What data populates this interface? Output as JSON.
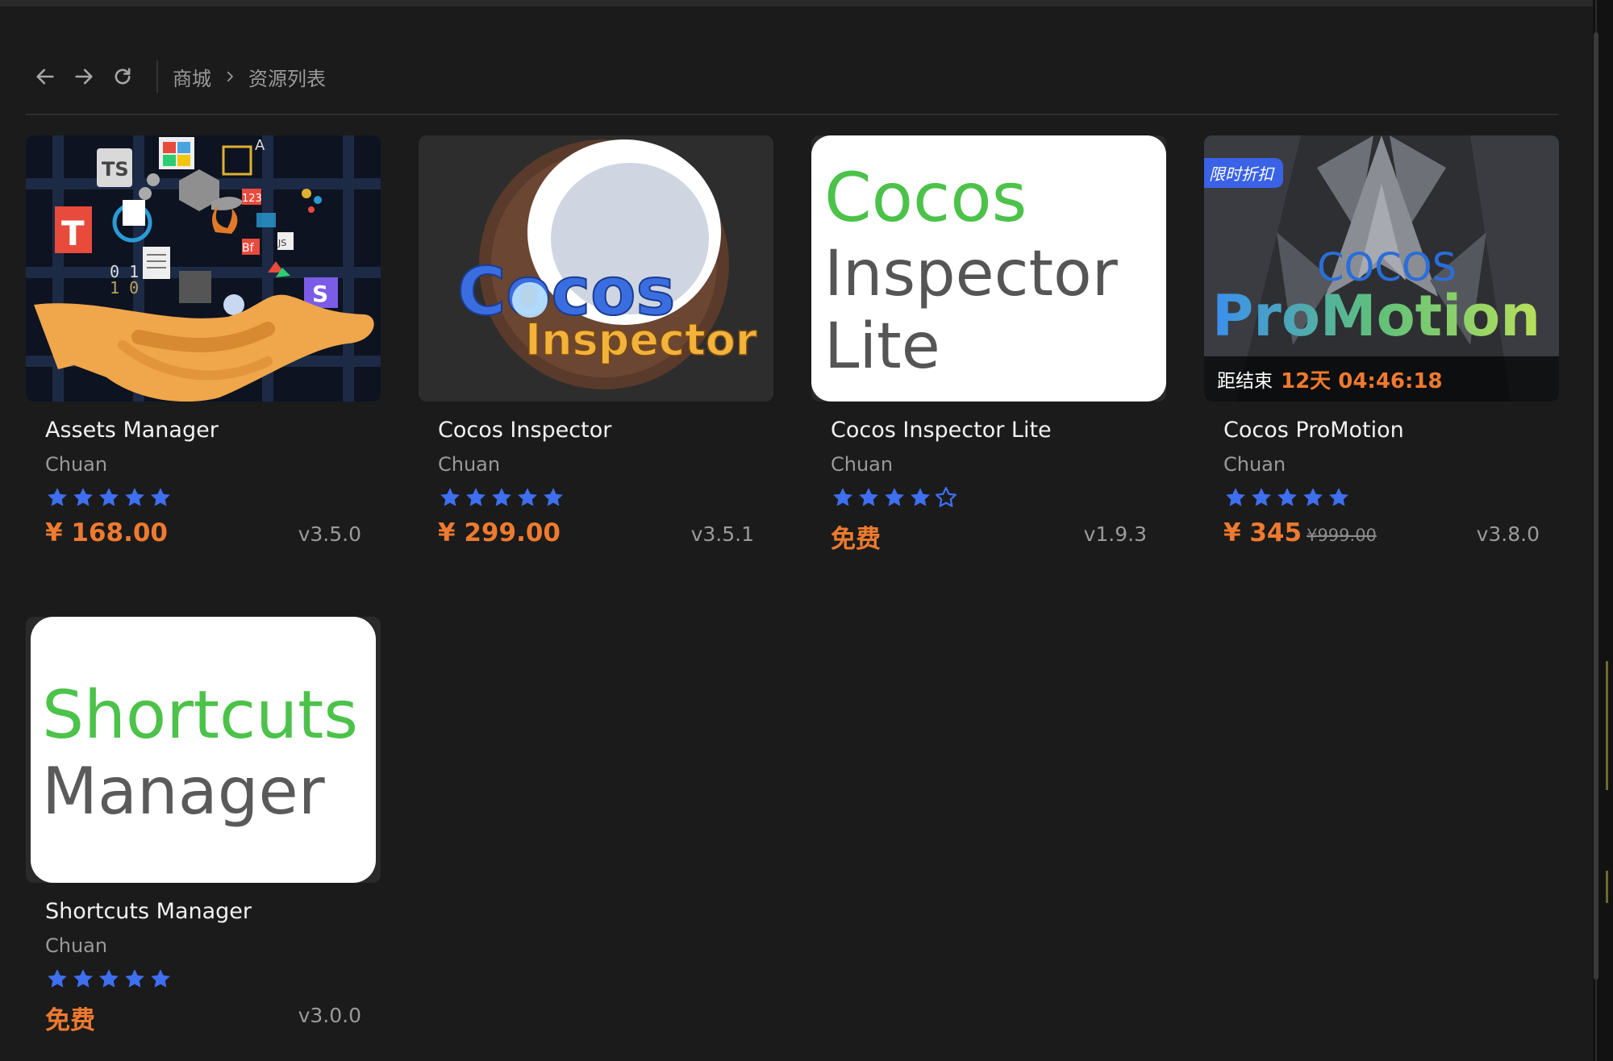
{
  "breadcrumb": {
    "root": "商城",
    "current": "资源列表"
  },
  "colors": {
    "accent": "#ef7a2f",
    "star": "#3e6ff0",
    "badge": "#3a62e6",
    "background": "#1b1b1b"
  },
  "cards": [
    {
      "title": "Assets Manager",
      "author": "Chuan",
      "rating": 5,
      "price": "¥ 168.00",
      "old_price": "",
      "version": "v3.5.0"
    },
    {
      "title": "Cocos Inspector",
      "author": "Chuan",
      "rating": 5,
      "price": "¥ 299.00",
      "old_price": "",
      "version": "v3.5.1",
      "thumb_text": [
        "Cocos",
        "Inspector"
      ]
    },
    {
      "title": "Cocos Inspector Lite",
      "author": "Chuan",
      "rating": 4,
      "price": "免费",
      "old_price": "",
      "version": "v1.9.3",
      "thumb_text": [
        "Cocos",
        "Inspector",
        "Lite"
      ]
    },
    {
      "title": "Cocos ProMotion",
      "author": "Chuan",
      "rating": 5,
      "price": "¥ 345",
      "old_price": "¥999.00",
      "version": "v3.8.0",
      "badge": "限时折扣",
      "countdown_label": "距结束",
      "countdown_value": "12天 04:46:18",
      "thumb_text": [
        "COCOS",
        "ProMotion"
      ]
    },
    {
      "title": "Shortcuts Manager",
      "author": "Chuan",
      "rating": 5,
      "price": "免费",
      "old_price": "",
      "version": "v3.0.0",
      "thumb_text": [
        "Shortcuts",
        "Manager"
      ]
    }
  ],
  "assets_thumb_text": {
    "ts": "TS",
    "t": "T",
    "bin": "0 1",
    "bin2": "1 0",
    "n123": "123",
    "bf": "Bf",
    "js": "JS",
    "s": "S",
    "a": "A"
  }
}
